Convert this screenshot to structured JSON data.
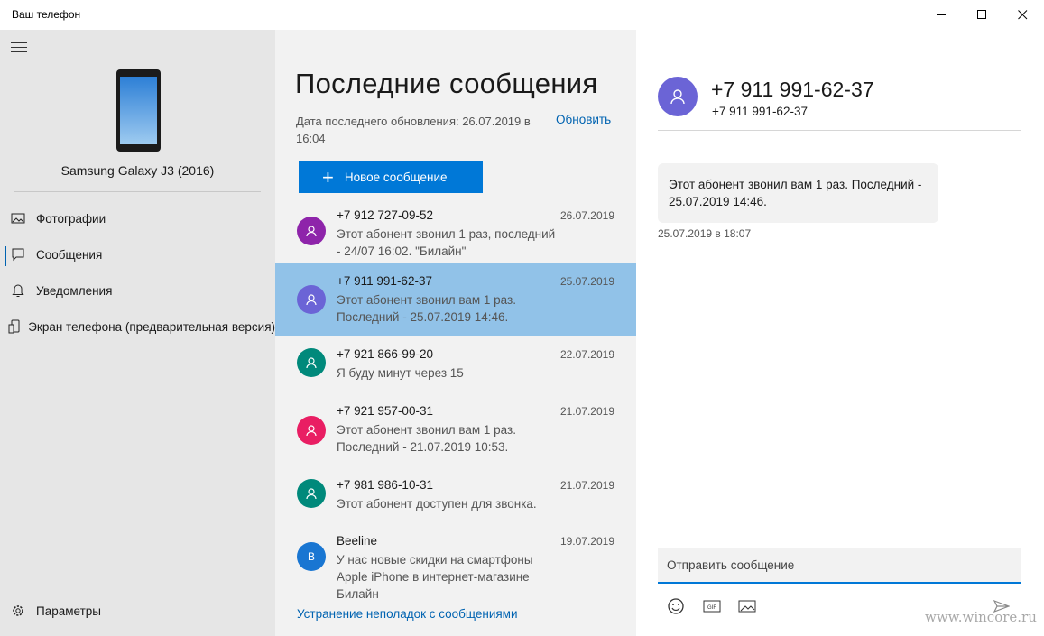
{
  "window": {
    "title": "Ваш телефон"
  },
  "nav": {
    "device_name": "Samsung Galaxy J3 (2016)",
    "items": [
      {
        "label": "Фотографии",
        "icon": "photo-icon"
      },
      {
        "label": "Сообщения",
        "icon": "chat-icon"
      },
      {
        "label": "Уведомления",
        "icon": "bell-icon"
      },
      {
        "label": "Экран телефона (предварительная версия)",
        "icon": "phone-screen-icon"
      }
    ],
    "settings_label": "Параметры"
  },
  "messages": {
    "title": "Последние сообщения",
    "updated": "Дата последнего обновления: 26.07.2019 в 16:04",
    "refresh_label": "Обновить",
    "new_message_label": "Новое сообщение",
    "troubleshoot_label": "Устранение неполадок с сообщениями",
    "items": [
      {
        "name": "+7 912 727-09-52",
        "date": "26.07.2019",
        "preview": "Этот абонент звонил 1 раз, последний\n- 24/07 16:02. \"Билайн\"",
        "color": "#8e24aa",
        "initial": ""
      },
      {
        "name": "+7 911 991-62-37",
        "date": "25.07.2019",
        "preview": "Этот абонент звонил вам 1 раз.\nПоследний - 25.07.2019 14:46.",
        "color": "#6b64d6",
        "initial": ""
      },
      {
        "name": "+7 921 866-99-20",
        "date": "22.07.2019",
        "preview": "Я буду минут через 15",
        "color": "#00897b",
        "initial": ""
      },
      {
        "name": "+7 921 957-00-31",
        "date": "21.07.2019",
        "preview": "Этот абонент звонил вам 1 раз.\nПоследний - 21.07.2019 10:53.",
        "color": "#e91e63",
        "initial": ""
      },
      {
        "name": "+7 981 986-10-31",
        "date": "21.07.2019",
        "preview": "Этот абонент доступен для звонка.",
        "color": "#00897b",
        "initial": ""
      },
      {
        "name": "Beeline",
        "date": "19.07.2019",
        "preview": "У нас новые скидки на смартфоны\nApple iPhone в интернет-магазине Билайн",
        "color": "#1976d2",
        "initial": "B"
      }
    ]
  },
  "conversation": {
    "name": "+7 911 991-62-37",
    "number": "+7 911 991-62-37",
    "bubble_text": "Этот абонент звонил вам 1 раз. Последний - 25.07.2019 14:46.",
    "bubble_time": "25.07.2019 в 18:07",
    "composer_placeholder": "Отправить сообщение",
    "gif_label": "GIF"
  },
  "watermark": "www.wincore.ru",
  "colors": {
    "accent": "#0078d7",
    "selected_row": "#91c2e8",
    "nav_bg": "#e6e6e6",
    "list_bg": "#f2f2f2"
  }
}
